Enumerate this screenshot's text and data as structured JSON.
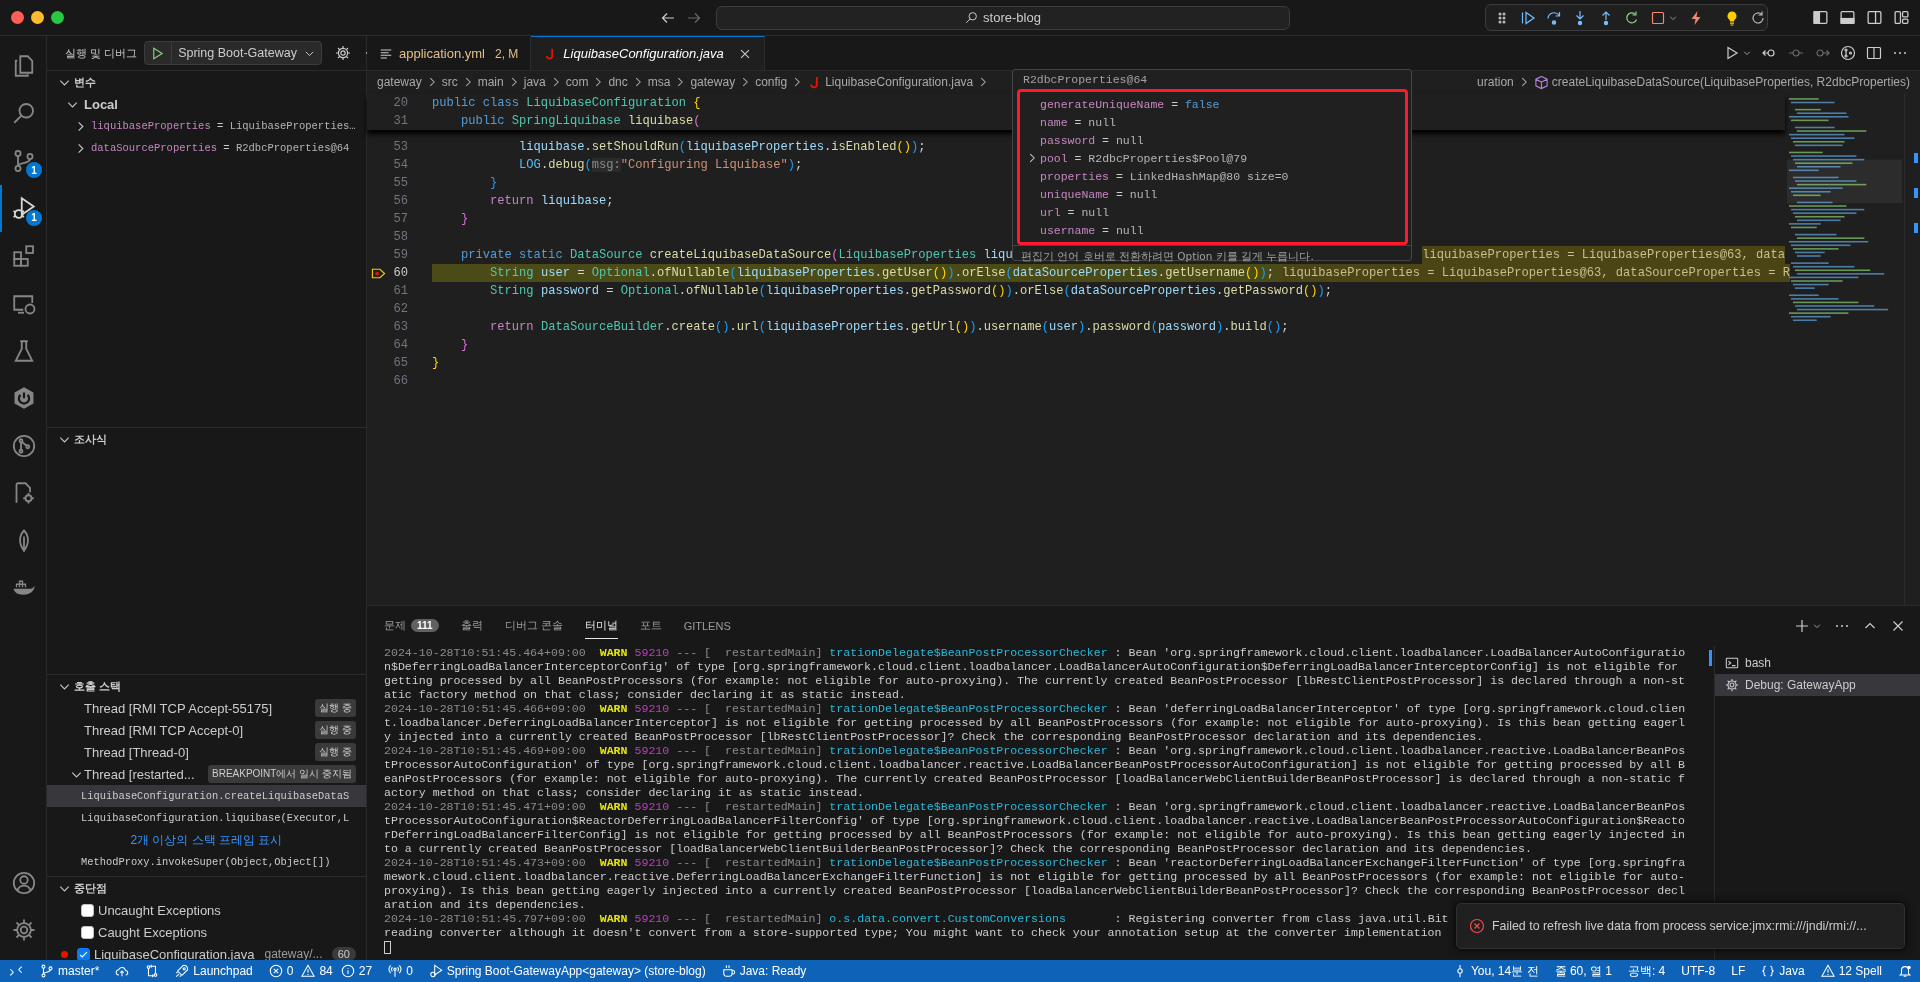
{
  "window": {
    "title": "store-blog"
  },
  "activity_bar": [
    {
      "kind": "explorer",
      "selected": false
    },
    {
      "kind": "search",
      "selected": false
    },
    {
      "kind": "source-control",
      "badge": "1",
      "selected": false
    },
    {
      "kind": "run-debug",
      "badge": "1",
      "selected": true
    },
    {
      "kind": "extensions",
      "selected": false
    },
    {
      "kind": "remote",
      "selected": false
    },
    {
      "kind": "testing",
      "selected": false
    },
    {
      "kind": "power",
      "selected": false
    },
    {
      "kind": "graph",
      "selected": false
    },
    {
      "kind": "doc-gear",
      "selected": false
    },
    {
      "kind": "leaf",
      "selected": false
    },
    {
      "kind": "whale",
      "selected": false
    }
  ],
  "activity_bar_bottom": [
    {
      "kind": "account",
      "selected": false
    },
    {
      "kind": "settings",
      "selected": false
    }
  ],
  "sidebar": {
    "title": "실행 및 디버그",
    "launch_config": "Spring Boot-Gateway",
    "variables": {
      "title": "변수",
      "expanded": true,
      "separator": "=",
      "scopes": [
        {
          "name": "Local",
          "expanded": true,
          "items": [
            {
              "name": "liquibaseProperties",
              "value": "LiquibaseProperties…",
              "expanded": false
            },
            {
              "name": "dataSourceProperties",
              "value": "R2dbcProperties@64",
              "expanded": false
            }
          ]
        }
      ]
    },
    "watch": {
      "title": "조사식",
      "expanded": true
    },
    "call_stack": {
      "title": "호출 스택",
      "expanded": true,
      "threads": [
        {
          "name": "Thread [RMI TCP Accept-55175]",
          "status": "실행 중"
        },
        {
          "name": "Thread [RMI TCP Accept-0]",
          "status": "실행 중"
        },
        {
          "name": "Thread [Thread-0]",
          "status": "실행 중"
        },
        {
          "name": "Thread [restarted...",
          "status": "BREAKPOINT에서 일시 중지됨",
          "expanded": true,
          "frames": [
            {
              "kind": "frame",
              "label": "LiquibaseConfiguration.createLiquibaseDataS",
              "selected": true
            },
            {
              "kind": "frame",
              "label": "LiquibaseConfiguration.liquibase(Executor,L",
              "selected": false
            },
            {
              "kind": "more",
              "label": "2개 이상의 스택 프레임 표시",
              "selected": false
            },
            {
              "kind": "frame",
              "label": "MethodProxy.invokeSuper(Object,Object[])",
              "selected": false
            }
          ]
        }
      ]
    },
    "breakpoints": {
      "title": "중단점",
      "expanded": true,
      "items": [
        {
          "kind": "exception",
          "label": "Uncaught Exceptions",
          "checked": false
        },
        {
          "kind": "exception",
          "label": "Caught Exceptions",
          "checked": false
        },
        {
          "kind": "file",
          "label": "LiquibaseConfiguration.java",
          "path": "gateway/...",
          "line": "60",
          "checked": true
        }
      ]
    }
  },
  "editor": {
    "tabs": [
      {
        "kind": "yaml",
        "label": "application.yml",
        "badge": "2, M",
        "modified": true,
        "preview": false,
        "selected": false
      },
      {
        "kind": "java",
        "label": "LiquibaseConfiguration.java",
        "modified": false,
        "preview": true,
        "selected": true
      }
    ],
    "breadcrumb": [
      {
        "kind": "folder",
        "label": "gateway"
      },
      {
        "kind": "folder",
        "label": "src"
      },
      {
        "kind": "folder",
        "label": "main"
      },
      {
        "kind": "folder",
        "label": "java"
      },
      {
        "kind": "folder",
        "label": "com"
      },
      {
        "kind": "folder",
        "label": "dnc"
      },
      {
        "kind": "folder",
        "label": "msa"
      },
      {
        "kind": "folder",
        "label": "gateway"
      },
      {
        "kind": "folder",
        "label": "config"
      },
      {
        "kind": "java",
        "label": "LiquibaseConfiguration.java"
      }
    ],
    "breadcrumb_tail": [
      {
        "label": "uration"
      },
      {
        "kind": "method",
        "label": "createLiquibaseDataSource(LiquibaseProperties, R2dbcProperties)"
      }
    ],
    "lines": [
      {
        "number": "20",
        "sticky": true,
        "tokens": [
          {
            "kind": "keyword",
            "text": "public class "
          },
          {
            "kind": "type",
            "text": "LiquibaseConfiguration "
          },
          {
            "kind": "bracket-1",
            "text": "{"
          }
        ]
      },
      {
        "number": "31",
        "sticky": true,
        "tokens": [
          {
            "kind": "keyword",
            "text": "    public "
          },
          {
            "kind": "type",
            "text": "SpringLiquibase "
          },
          {
            "kind": "function",
            "text": "liquibase"
          },
          {
            "kind": "bracket-2",
            "text": "("
          }
        ]
      },
      {
        "number": "53",
        "tokens": [
          {
            "kind": "variable",
            "text": "            liquibase"
          },
          {
            "kind": "punctuation",
            "text": "."
          },
          {
            "kind": "function",
            "text": "setShouldRun"
          },
          {
            "kind": "bracket-3",
            "text": "("
          },
          {
            "kind": "variable",
            "text": "liquibaseProperties"
          },
          {
            "kind": "punctuation",
            "text": "."
          },
          {
            "kind": "function",
            "text": "isEnabled"
          },
          {
            "kind": "bracket-1",
            "text": "()"
          },
          {
            "kind": "bracket-3",
            "text": ")"
          },
          {
            "kind": "punctuation",
            "text": ";"
          }
        ]
      },
      {
        "number": "54",
        "tokens": [
          {
            "kind": "constant",
            "text": "            LOG"
          },
          {
            "kind": "punctuation",
            "text": "."
          },
          {
            "kind": "function",
            "text": "debug"
          },
          {
            "kind": "bracket-3",
            "text": "("
          },
          {
            "kind": "hint",
            "text": "msg:"
          },
          {
            "kind": "string",
            "text": "\"Configuring Liquibase\""
          },
          {
            "kind": "bracket-3",
            "text": ")"
          },
          {
            "kind": "punctuation",
            "text": ";"
          }
        ]
      },
      {
        "number": "55",
        "tokens": [
          {
            "kind": "bracket-3",
            "text": "        }"
          }
        ]
      },
      {
        "number": "56",
        "tokens": [
          {
            "kind": "control",
            "text": "        return "
          },
          {
            "kind": "variable",
            "text": "liquibase"
          },
          {
            "kind": "punctuation",
            "text": ";"
          }
        ]
      },
      {
        "number": "57",
        "tokens": [
          {
            "kind": "bracket-2",
            "text": "    }"
          }
        ]
      },
      {
        "number": "58"
      },
      {
        "number": "59",
        "tokens": [
          {
            "kind": "keyword",
            "text": "    private static "
          },
          {
            "kind": "type",
            "text": "DataSource "
          },
          {
            "kind": "function",
            "text": "createLiquibaseDataSource"
          },
          {
            "kind": "bracket-2",
            "text": "("
          },
          {
            "kind": "type",
            "text": "LiquibaseProperties "
          },
          {
            "kind": "variable",
            "text": "liqu"
          }
        ],
        "inline_value": {
          "kind": "aligned",
          "text": "liquibaseProperties = LiquibaseProperties@63, data"
        }
      },
      {
        "number": "60",
        "current": true,
        "tokens": [
          {
            "kind": "type",
            "text": "        String "
          },
          {
            "kind": "variable",
            "text": "user"
          },
          {
            "kind": "punctuation",
            "text": " = "
          },
          {
            "kind": "type",
            "text": "Optional"
          },
          {
            "kind": "punctuation",
            "text": "."
          },
          {
            "kind": "function",
            "text": "ofNullable"
          },
          {
            "kind": "bracket-3",
            "text": "("
          },
          {
            "kind": "variable",
            "text": "liquibaseProperties"
          },
          {
            "kind": "punctuation",
            "text": "."
          },
          {
            "kind": "function",
            "text": "getUser"
          },
          {
            "kind": "bracket-1",
            "text": "()"
          },
          {
            "kind": "bracket-3",
            "text": ")"
          },
          {
            "kind": "punctuation",
            "text": "."
          },
          {
            "kind": "function",
            "text": "orElse"
          },
          {
            "kind": "bracket-3",
            "text": "("
          },
          {
            "kind": "variable",
            "text": "dataSourceProperties"
          },
          {
            "kind": "punctuation",
            "text": "."
          },
          {
            "kind": "function",
            "text": "getUsername"
          },
          {
            "kind": "bracket-1",
            "text": "()"
          },
          {
            "kind": "bracket-3",
            "text": ")"
          },
          {
            "kind": "punctuation",
            "text": ";"
          }
        ],
        "inline_value": {
          "kind": "trailing",
          "text": "liquibaseProperties = LiquibaseProperties@63, dataSourceProperties = R"
        }
      },
      {
        "number": "61",
        "tokens": [
          {
            "kind": "type",
            "text": "        String "
          },
          {
            "kind": "variable",
            "text": "password"
          },
          {
            "kind": "punctuation",
            "text": " = "
          },
          {
            "kind": "type",
            "text": "Optional"
          },
          {
            "kind": "punctuation",
            "text": "."
          },
          {
            "kind": "function",
            "text": "ofNullable"
          },
          {
            "kind": "bracket-3",
            "text": "("
          },
          {
            "kind": "variable",
            "text": "liquibaseProperties"
          },
          {
            "kind": "punctuation",
            "text": "."
          },
          {
            "kind": "function",
            "text": "getPassword"
          },
          {
            "kind": "bracket-1",
            "text": "()"
          },
          {
            "kind": "bracket-3",
            "text": ")"
          },
          {
            "kind": "punctuation",
            "text": "."
          },
          {
            "kind": "function",
            "text": "orElse"
          },
          {
            "kind": "bracket-3",
            "text": "("
          },
          {
            "kind": "variable",
            "text": "dataSourceProperties"
          },
          {
            "kind": "punctuation",
            "text": "."
          },
          {
            "kind": "function",
            "text": "getPassword"
          },
          {
            "kind": "bracket-1",
            "text": "()"
          },
          {
            "kind": "bracket-3",
            "text": ")"
          },
          {
            "kind": "punctuation",
            "text": ";"
          }
        ]
      },
      {
        "number": "62"
      },
      {
        "number": "63",
        "tokens": [
          {
            "kind": "control",
            "text": "        return "
          },
          {
            "kind": "type",
            "text": "DataSourceBuilder"
          },
          {
            "kind": "punctuation",
            "text": "."
          },
          {
            "kind": "function",
            "text": "create"
          },
          {
            "kind": "bracket-3",
            "text": "()"
          },
          {
            "kind": "punctuation",
            "text": "."
          },
          {
            "kind": "function",
            "text": "url"
          },
          {
            "kind": "bracket-3",
            "text": "("
          },
          {
            "kind": "variable",
            "text": "liquibaseProperties"
          },
          {
            "kind": "punctuation",
            "text": "."
          },
          {
            "kind": "function",
            "text": "getUrl"
          },
          {
            "kind": "bracket-1",
            "text": "()"
          },
          {
            "kind": "bracket-3",
            "text": ")"
          },
          {
            "kind": "punctuation",
            "text": "."
          },
          {
            "kind": "function",
            "text": "username"
          },
          {
            "kind": "bracket-3",
            "text": "("
          },
          {
            "kind": "variable",
            "text": "user"
          },
          {
            "kind": "bracket-3",
            "text": ")"
          },
          {
            "kind": "punctuation",
            "text": "."
          },
          {
            "kind": "function",
            "text": "password"
          },
          {
            "kind": "bracket-3",
            "text": "("
          },
          {
            "kind": "variable",
            "text": "password"
          },
          {
            "kind": "bracket-3",
            "text": ")"
          },
          {
            "kind": "punctuation",
            "text": "."
          },
          {
            "kind": "function",
            "text": "build"
          },
          {
            "kind": "bracket-3",
            "text": "()"
          },
          {
            "kind": "punctuation",
            "text": ";"
          }
        ]
      },
      {
        "number": "64",
        "tokens": [
          {
            "kind": "bracket-2",
            "text": "    }"
          }
        ]
      },
      {
        "number": "65",
        "tokens": [
          {
            "kind": "bracket-1",
            "text": "}"
          }
        ]
      },
      {
        "number": "66"
      }
    ],
    "hover": {
      "title": "R2dbcProperties@64",
      "highlighted": true,
      "separator": "=",
      "items": [
        {
          "name": "generateUniqueName",
          "value": "false",
          "kind": "boolean"
        },
        {
          "name": "name",
          "value": "null",
          "kind": "null"
        },
        {
          "name": "password",
          "value": "null",
          "kind": "null"
        },
        {
          "name": "pool",
          "value": "R2dbcProperties$Pool@79",
          "kind": "object",
          "expanded": false
        },
        {
          "name": "properties",
          "value": "LinkedHashMap@80 size=0",
          "kind": "object"
        },
        {
          "name": "uniqueName",
          "value": "null",
          "kind": "null"
        },
        {
          "name": "url",
          "value": "null",
          "kind": "null"
        },
        {
          "name": "username",
          "value": "null",
          "kind": "null"
        }
      ],
      "hint": "편집기 언어 호버로 전환하려면 Option 키를 길게 누릅니다."
    }
  },
  "panel": {
    "tabs": [
      {
        "label": "문제",
        "badge": "111",
        "selected": false
      },
      {
        "label": "출력",
        "selected": false
      },
      {
        "label": "디버그 콘솔",
        "selected": false
      },
      {
        "label": "터미널",
        "selected": true
      },
      {
        "label": "포트",
        "selected": false
      },
      {
        "label": "GITLENS",
        "selected": false
      }
    ],
    "terminal": {
      "logs": [
        {
          "timestamp": "2024-10-28T10:51:45.464+09:00",
          "level": "WARN",
          "pid": "59210",
          "sep": "---",
          "thread": "[  restartedMain]",
          "logger": "trationDelegate$BeanPostProcessorChecker",
          "message": [
            ": Bean 'org.springframework.cloud.client.loadbalancer.LoadBalancerAutoConfiguratio",
            "n$DeferringLoadBalancerInterceptorConfig' of type [org.springframework.cloud.client.loadbalancer.LoadBalancerAutoConfiguration$DeferringLoadBalancerInterceptorConfig] is not eligible for",
            "getting processed by all BeanPostProcessors (for example: not eligible for auto-proxying). The currently created BeanPostProcessor [lbRestClientPostProcessor] is declared through a non-st",
            "atic factory method on that class; consider declaring it as static instead."
          ]
        },
        {
          "timestamp": "2024-10-28T10:51:45.466+09:00",
          "level": "WARN",
          "pid": "59210",
          "sep": "---",
          "thread": "[  restartedMain]",
          "logger": "trationDelegate$BeanPostProcessorChecker",
          "message": [
            ": Bean 'deferringLoadBalancerInterceptor' of type [org.springframework.cloud.clien",
            "t.loadbalancer.DeferringLoadBalancerInterceptor] is not eligible for getting processed by all BeanPostProcessors (for example: not eligible for auto-proxying). Is this bean getting eagerl",
            "y injected into a currently created BeanPostProcessor [lbRestClientPostProcessor]? Check the corresponding BeanPostProcessor declaration and its dependencies."
          ]
        },
        {
          "timestamp": "2024-10-28T10:51:45.469+09:00",
          "level": "WARN",
          "pid": "59210",
          "sep": "---",
          "thread": "[  restartedMain]",
          "logger": "trationDelegate$BeanPostProcessorChecker",
          "message": [
            ": Bean 'org.springframework.cloud.client.loadbalancer.reactive.LoadBalancerBeanPos",
            "tProcessorAutoConfiguration' of type [org.springframework.cloud.client.loadbalancer.reactive.LoadBalancerBeanPostProcessorAutoConfiguration] is not eligible for getting processed by all B",
            "eanPostProcessors (for example: not eligible for auto-proxying). The currently created BeanPostProcessor [loadBalancerWebClientBuilderBeanPostProcessor] is declared through a non-static f",
            "actory method on that class; consider declaring it as static instead."
          ]
        },
        {
          "timestamp": "2024-10-28T10:51:45.471+09:00",
          "level": "WARN",
          "pid": "59210",
          "sep": "---",
          "thread": "[  restartedMain]",
          "logger": "trationDelegate$BeanPostProcessorChecker",
          "message": [
            ": Bean 'org.springframework.cloud.client.loadbalancer.reactive.LoadBalancerBeanPos",
            "tProcessorAutoConfiguration$ReactorDeferringLoadBalancerFilterConfig' of type [org.springframework.cloud.client.loadbalancer.reactive.LoadBalancerBeanPostProcessorAutoConfiguration$Reacto",
            "rDeferringLoadBalancerFilterConfig] is not eligible for getting processed by all BeanPostProcessors (for example: not eligible for auto-proxying). Is this bean getting eagerly injected in",
            "to a currently created BeanPostProcessor [loadBalancerWebClientBuilderBeanPostProcessor]? Check the corresponding BeanPostProcessor declaration and its dependencies."
          ]
        },
        {
          "timestamp": "2024-10-28T10:51:45.473+09:00",
          "level": "WARN",
          "pid": "59210",
          "sep": "---",
          "thread": "[  restartedMain]",
          "logger": "trationDelegate$BeanPostProcessorChecker",
          "message": [
            ": Bean 'reactorDeferringLoadBalancerExchangeFilterFunction' of type [org.springfra",
            "mework.cloud.client.loadbalancer.reactive.DeferringLoadBalancerExchangeFilterFunction] is not eligible for getting processed by all BeanPostProcessors (for example: not eligible for auto-",
            "proxying). Is this bean getting eagerly injected into a currently created BeanPostProcessor [loadBalancerWebClientBuilderBeanPostProcessor]? Check the corresponding BeanPostProcessor decl",
            "aration and its dependencies."
          ]
        },
        {
          "timestamp": "2024-10-28T10:51:45.797+09:00",
          "level": "WARN",
          "pid": "59210",
          "sep": "---",
          "thread": "[  restartedMain]",
          "logger": "o.s.data.convert.CustomConversions",
          "message": [
            ": Registering converter from class java.util.Bit",
            "reading converter although it doesn't convert from a store-supported type; You might want to check your annotation setup at the converter implementation"
          ]
        }
      ],
      "cursor": true,
      "sessions": [
        {
          "kind": "shell",
          "label": "bash",
          "selected": false
        },
        {
          "kind": "debug",
          "label": "Debug: GatewayApp",
          "selected": true
        }
      ]
    }
  },
  "notification": {
    "kind": "error",
    "message": "Failed to refresh live data from process service:jmx:rmi:///jndi/rmi://..."
  },
  "status_bar": {
    "left": [
      {
        "kind": "remote"
      },
      {
        "kind": "branch",
        "label": "master*"
      },
      {
        "kind": "sync"
      },
      {
        "kind": "compare"
      },
      {
        "kind": "launchpad",
        "label": "Launchpad"
      },
      {
        "kind": "problems",
        "errors": "0",
        "warnings": "84",
        "infos": "27"
      },
      {
        "kind": "ports",
        "label": "0"
      },
      {
        "kind": "debug",
        "label": "Spring Boot-GatewayApp<gateway> (store-blog)"
      },
      {
        "kind": "java",
        "label": "Java: Ready"
      }
    ],
    "right": [
      {
        "kind": "blame",
        "label": "You, 14분 전"
      },
      {
        "kind": "text",
        "label": "줄 60, 열 1"
      },
      {
        "kind": "text",
        "label": "공백: 4"
      },
      {
        "kind": "text",
        "label": "UTF-8"
      },
      {
        "kind": "text",
        "label": "LF"
      },
      {
        "kind": "language",
        "label": "Java"
      },
      {
        "kind": "spell",
        "label": "12 Spell"
      },
      {
        "kind": "bell"
      }
    ]
  }
}
